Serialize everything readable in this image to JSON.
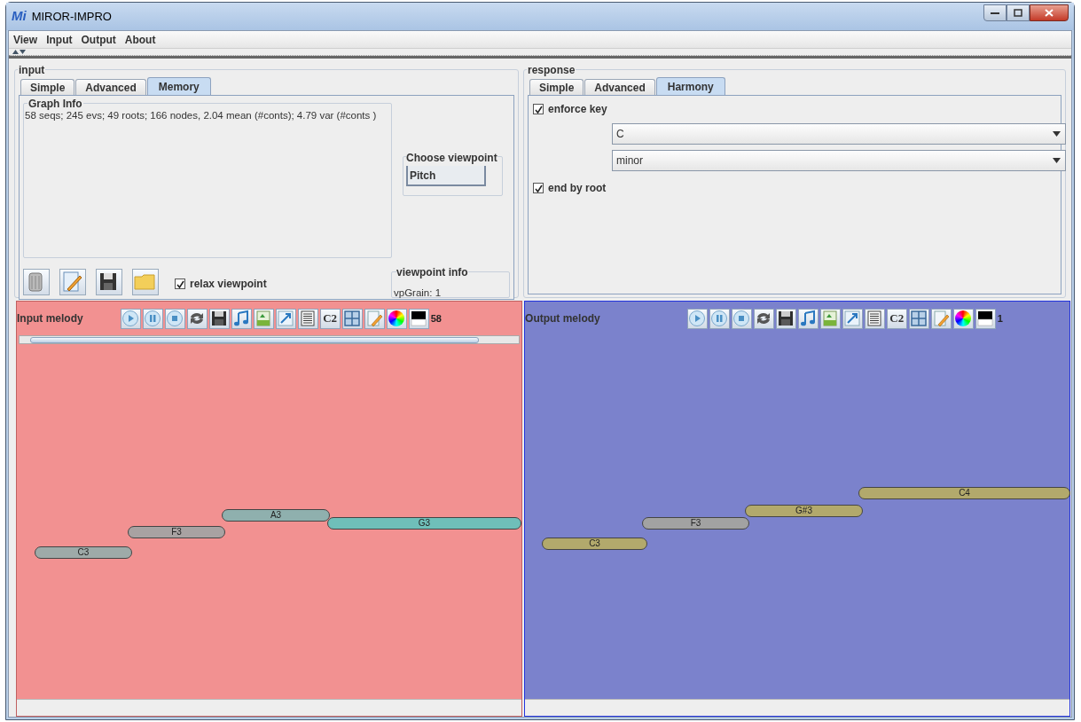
{
  "window": {
    "logo": "Mi",
    "title": "MIROR-IMPRO"
  },
  "menu": [
    "View",
    "Input",
    "Output",
    "About"
  ],
  "input": {
    "title": "input",
    "tabs": [
      {
        "label": "Simple",
        "selected": false
      },
      {
        "label": "Advanced",
        "selected": false
      },
      {
        "label": "Memory",
        "selected": true
      }
    ],
    "graph_info": {
      "title": "Graph Info",
      "text": "58 seqs; 245 evs; 49 roots; 166 nodes, 2.04 mean (#conts); 4.79 var (#conts )"
    },
    "choose_viewpoint": {
      "title": "Choose viewpoint",
      "value": "Pitch"
    },
    "relax_viewpoint": {
      "label": "relax viewpoint",
      "checked": true
    },
    "viewpoint_info": {
      "title": "viewpoint info",
      "text": "vpGrain: 1"
    }
  },
  "response": {
    "title": "response",
    "tabs": [
      {
        "label": "Simple",
        "selected": false
      },
      {
        "label": "Advanced",
        "selected": false
      },
      {
        "label": "Harmony",
        "selected": true
      }
    ],
    "enforce_key": {
      "label": "enforce key",
      "checked": true
    },
    "key": "C",
    "mode": "minor",
    "end_by_root": {
      "label": "end by root",
      "checked": true
    }
  },
  "melodies": [
    {
      "title": "Input melody",
      "count": "58",
      "scrollbar": true,
      "toolbar": [
        {
          "kind": "play"
        },
        {
          "kind": "pause"
        },
        {
          "kind": "stop"
        },
        {
          "kind": "loop"
        },
        {
          "kind": "save"
        },
        {
          "kind": "note"
        },
        {
          "kind": "image"
        },
        {
          "kind": "resize"
        },
        {
          "kind": "lines"
        },
        {
          "kind": "text",
          "label": "C2"
        },
        {
          "kind": "grid"
        },
        {
          "kind": "edit"
        },
        {
          "kind": "color"
        },
        {
          "kind": "contrast"
        }
      ],
      "notes": [
        {
          "label": "C3",
          "color": "#9eaaa8"
        },
        {
          "label": "F3",
          "color": "#a8a2a2"
        },
        {
          "label": "A3",
          "color": "#8fb0ae"
        },
        {
          "label": "G3",
          "color": "#6fbfb9"
        }
      ]
    },
    {
      "title": "Output melody",
      "count": "1",
      "scrollbar": false,
      "toolbar": [
        {
          "kind": "play"
        },
        {
          "kind": "pause"
        },
        {
          "kind": "stop"
        },
        {
          "kind": "loop"
        },
        {
          "kind": "save"
        },
        {
          "kind": "note"
        },
        {
          "kind": "image"
        },
        {
          "kind": "resize"
        },
        {
          "kind": "lines"
        },
        {
          "kind": "text",
          "label": "C2"
        },
        {
          "kind": "grid"
        },
        {
          "kind": "edit"
        },
        {
          "kind": "color"
        },
        {
          "kind": "contrast"
        }
      ],
      "notes": [
        {
          "label": "C3",
          "color": "#b2a96c"
        },
        {
          "label": "F3",
          "color": "#a2a2a2"
        },
        {
          "label": "G#3",
          "color": "#b2a96c"
        },
        {
          "label": "C4",
          "color": "#b2a96c"
        }
      ]
    }
  ]
}
